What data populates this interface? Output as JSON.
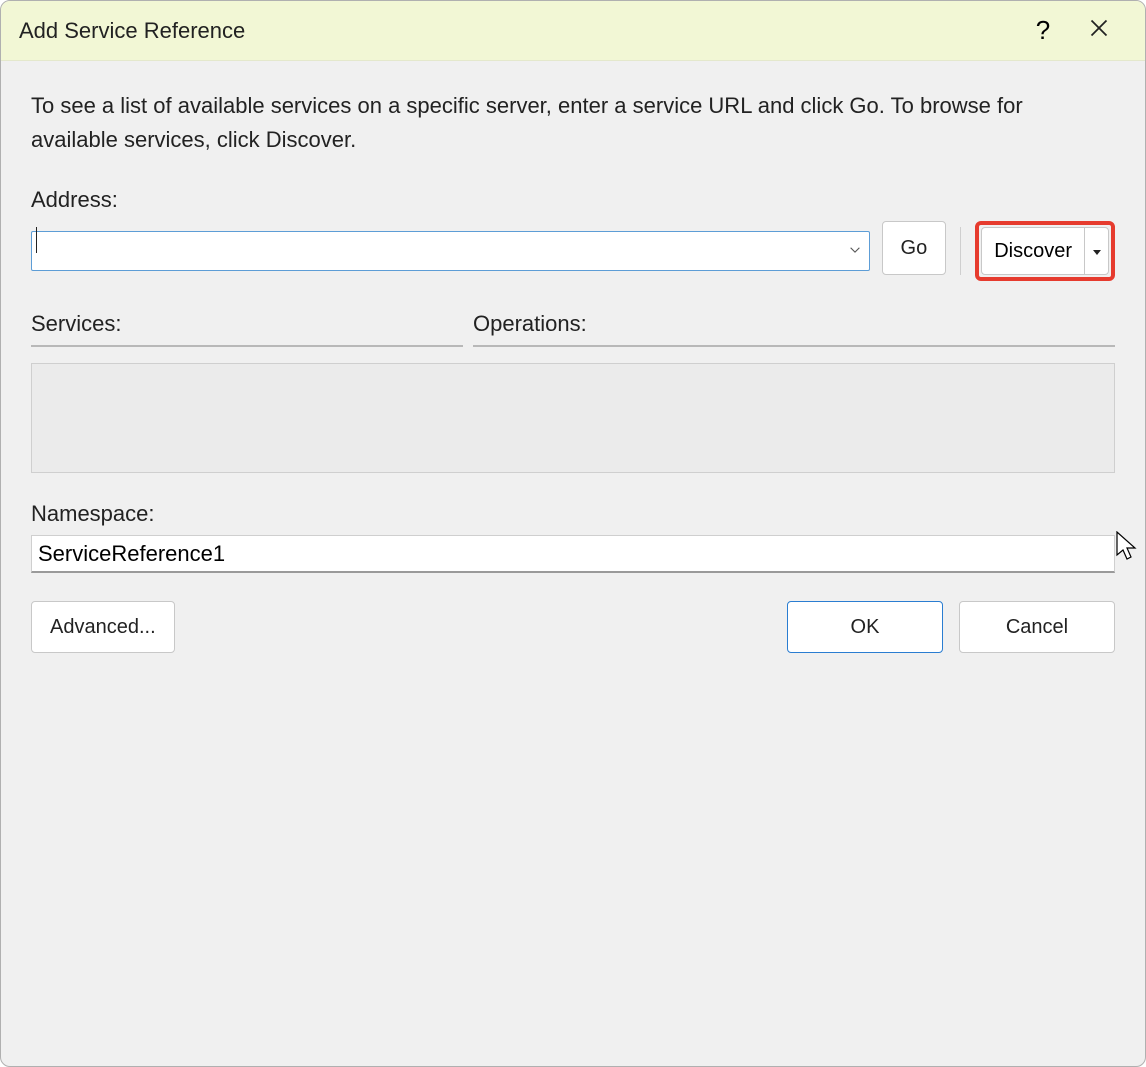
{
  "dialog": {
    "title": "Add Service Reference",
    "instruction": "To see a list of available services on a specific server, enter a service URL and click Go. To browse for available services, click Discover."
  },
  "address": {
    "label": "Address:",
    "value": "",
    "go_label": "Go",
    "discover_label": "Discover"
  },
  "lists": {
    "services_label": "Services:",
    "operations_label": "Operations:"
  },
  "namespace": {
    "label": "Namespace:",
    "value": "ServiceReference1"
  },
  "footer": {
    "advanced_label": "Advanced...",
    "ok_label": "OK",
    "cancel_label": "Cancel"
  },
  "highlight": {
    "element": "discover-button"
  }
}
